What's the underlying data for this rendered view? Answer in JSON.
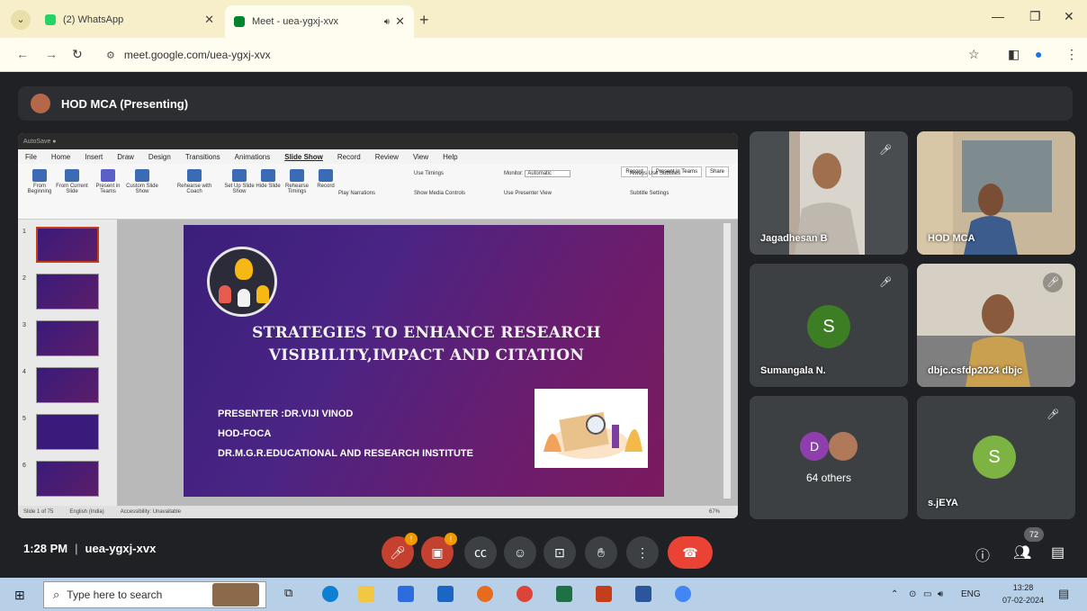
{
  "browser": {
    "tabs": [
      {
        "title": "(2) WhatsApp",
        "active": false,
        "favicon_color": "#25d366"
      },
      {
        "title": "Meet - uea-ygxj-xvx",
        "active": true,
        "favicon_color": "#00832d"
      }
    ],
    "url": "meet.google.com/uea-ygxj-xvx"
  },
  "meet": {
    "presenting_label": "HOD MCA (Presenting)",
    "time": "1:28 PM",
    "meeting_code": "uea-ygxj-xvx",
    "participant_count": "72",
    "participants": [
      {
        "name": "Jagadhesan B",
        "type": "video",
        "muted": true
      },
      {
        "name": "HOD MCA",
        "type": "video",
        "muted": false
      },
      {
        "name": "Sumangala N.",
        "type": "avatar",
        "letter": "S",
        "avatar_color": "#3d7d23",
        "muted": true
      },
      {
        "name": "dbjc.csfdp2024 dbjc",
        "type": "video",
        "muted": true
      },
      {
        "name": "64 others",
        "type": "group",
        "letter": "D",
        "avatar_color": "#8e3fad"
      },
      {
        "name": "s.jEYA",
        "type": "avatar",
        "letter": "S",
        "avatar_color": "#7cb342",
        "muted": true
      }
    ],
    "controls": {
      "mic_badge": "!",
      "cam_badge": "!"
    }
  },
  "presentation": {
    "menu": [
      "File",
      "Home",
      "Insert",
      "Draw",
      "Design",
      "Transitions",
      "Animations",
      "Slide Show",
      "Record",
      "Review",
      "View",
      "Help"
    ],
    "active_menu": "Slide Show",
    "ribbon_buttons": {
      "record": "Record",
      "present_in_teams": "Present in Teams",
      "share": "Share"
    },
    "ribbon_groups": [
      "From Beginning",
      "From Current Slide",
      "Present in Teams",
      "Custom Slide Show",
      "Rehearse with Coach",
      "Set Up Slide Show",
      "Hide Slide",
      "Rehearse Timings",
      "Record"
    ],
    "ribbon_checks": [
      "Play Narrations",
      "Use Timings",
      "Show Media Controls",
      "Use Presenter View",
      "Always Use Subtitles",
      "Subtitle Settings"
    ],
    "monitor_label": "Monitor:",
    "monitor_value": "Automatic",
    "slide_numbers": [
      "1",
      "2",
      "3",
      "4",
      "5",
      "6"
    ],
    "slide": {
      "title_line1": "STRATEGIES TO ENHANCE RESEARCH",
      "title_line2": "VISIBILITY,IMPACT AND CITATION",
      "presenter": "PRESENTER :DR.VIJI VINOD",
      "role": "HOD-FOCA",
      "institute": "DR.M.G.R.EDUCATIONAL AND RESEARCH INSTITUTE"
    },
    "status": {
      "slide_info": "Slide 1 of 75",
      "language": "English (India)",
      "accessibility": "Accessibility: Unavailable",
      "zoom": "67%"
    }
  },
  "taskbar": {
    "search_placeholder": "Type here to search",
    "language": "ENG",
    "time": "13:28",
    "date": "07-02-2024"
  }
}
